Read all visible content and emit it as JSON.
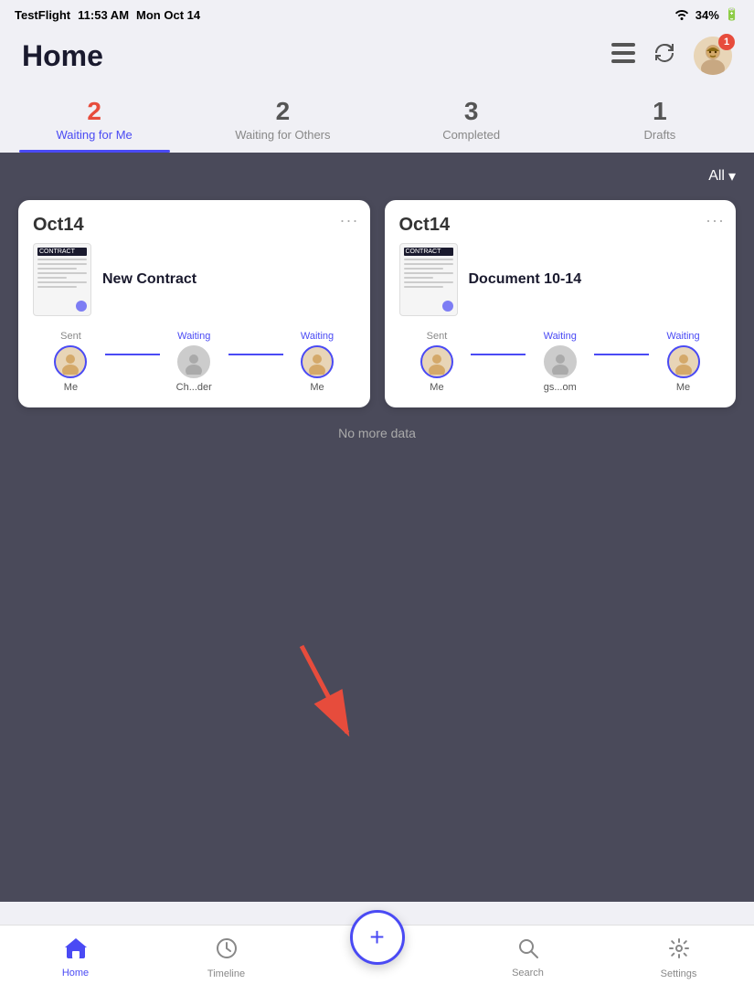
{
  "statusBar": {
    "app": "TestFlight",
    "time": "11:53 AM",
    "date": "Mon Oct 14",
    "wifi": "▼",
    "battery": "34%"
  },
  "header": {
    "title": "Home",
    "listIconLabel": "list-icon",
    "refreshIconLabel": "refresh-icon",
    "avatarBadge": "1"
  },
  "tabs": [
    {
      "id": "waiting-for-me",
      "count": "2",
      "label": "Waiting for Me",
      "active": true,
      "countColor": "red"
    },
    {
      "id": "waiting-for-others",
      "count": "2",
      "label": "Waiting for Others",
      "active": false,
      "countColor": "grey"
    },
    {
      "id": "completed",
      "count": "3",
      "label": "Completed",
      "active": false,
      "countColor": "grey"
    },
    {
      "id": "drafts",
      "count": "1",
      "label": "Drafts",
      "active": false,
      "countColor": "grey"
    }
  ],
  "filter": {
    "label": "All",
    "icon": "▾"
  },
  "cards": [
    {
      "id": "card-1",
      "datePrefix": "Oct",
      "dateNum": "14",
      "docName": "New Contract",
      "signers": [
        {
          "status": "Sent",
          "name": "Me",
          "type": "person",
          "statusColor": "grey"
        },
        {
          "status": "Waiting",
          "name": "Ch...der",
          "type": "grey",
          "statusColor": "blue"
        },
        {
          "status": "Waiting",
          "name": "Me",
          "type": "person",
          "statusColor": "blue"
        }
      ]
    },
    {
      "id": "card-2",
      "datePrefix": "Oct",
      "dateNum": "14",
      "docName": "Document 10-14",
      "signers": [
        {
          "status": "Sent",
          "name": "Me",
          "type": "person",
          "statusColor": "grey"
        },
        {
          "status": "Waiting",
          "name": "gs...om",
          "type": "grey",
          "statusColor": "blue"
        },
        {
          "status": "Waiting",
          "name": "Me",
          "type": "person",
          "statusColor": "blue"
        }
      ]
    }
  ],
  "noMoreData": "No more data",
  "bottomTabs": [
    {
      "id": "home",
      "icon": "🏠",
      "label": "Home",
      "active": true
    },
    {
      "id": "timeline",
      "icon": "🕐",
      "label": "Timeline",
      "active": false
    },
    {
      "id": "add",
      "icon": "+",
      "label": "",
      "active": false,
      "isFab": true
    },
    {
      "id": "search",
      "icon": "🔍",
      "label": "Search",
      "active": false
    },
    {
      "id": "settings",
      "icon": "⚙️",
      "label": "Settings",
      "active": false
    }
  ]
}
